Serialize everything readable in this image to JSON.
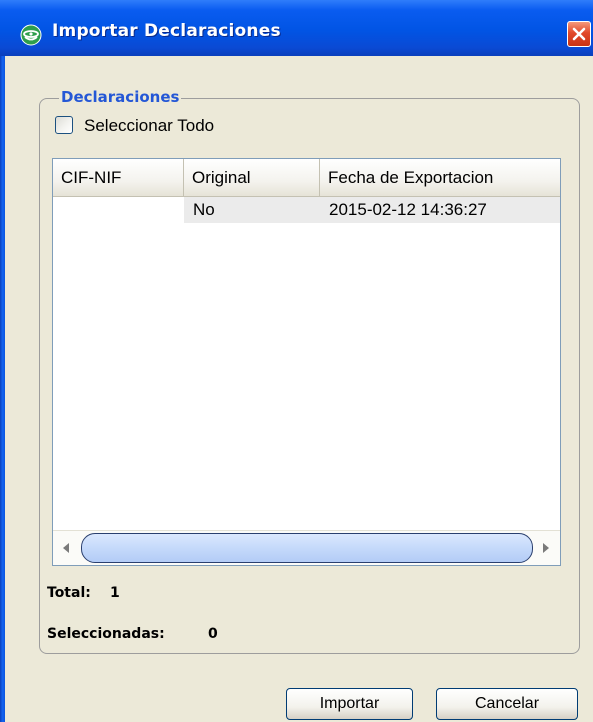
{
  "window": {
    "title": "Importar Declaraciones",
    "title_icon": "app-logo-icon",
    "close_icon": "close-icon"
  },
  "group": {
    "legend": "Declaraciones",
    "select_all": {
      "label": "Seleccionar Todo",
      "checked": false
    }
  },
  "table": {
    "columns": [
      "CIF-NIF",
      "Original",
      "Fecha de Exportacion"
    ],
    "rows": [
      {
        "cif_nif": "",
        "original": "No",
        "fecha": "2015-02-12 14:36:27"
      }
    ]
  },
  "summary": {
    "total_label": "Total:",
    "total_value": "1",
    "selected_label": "Seleccionadas:",
    "selected_value": "0"
  },
  "buttons": {
    "import_label": "Importar",
    "cancel_label": "Cancelar"
  },
  "colors": {
    "titlebar": "#0154e4",
    "legend_text": "#2457d6",
    "window_bg": "#ece9d8",
    "close_button": "#e2492a"
  }
}
